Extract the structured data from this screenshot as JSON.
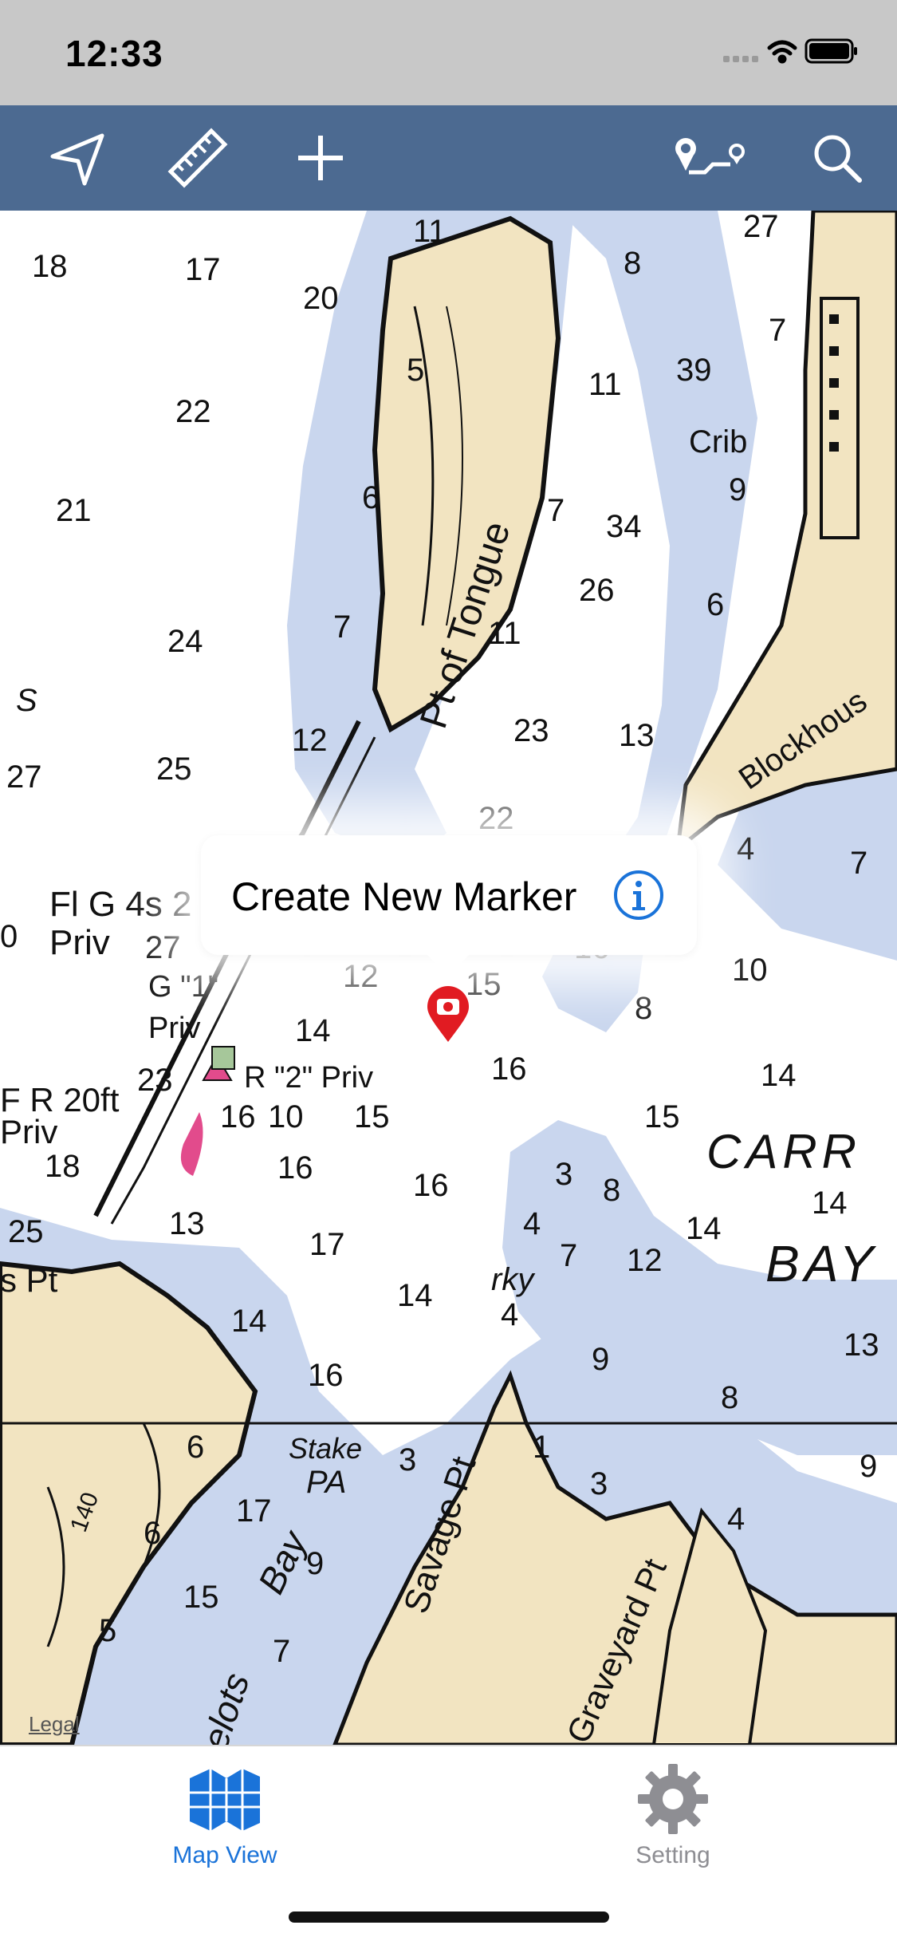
{
  "status_bar": {
    "time": "12:33",
    "icons": [
      "signal-icon",
      "wifi-icon",
      "battery-icon"
    ]
  },
  "toolbar": {
    "buttons": [
      {
        "name": "navigate-icon"
      },
      {
        "name": "ruler-icon"
      },
      {
        "name": "add-icon"
      },
      {
        "name": "route-icon"
      },
      {
        "name": "search-icon"
      }
    ],
    "background": "#4c6a91"
  },
  "map": {
    "legal_label": "Legal",
    "depth_soundings": [
      "11",
      "27",
      "18",
      "17",
      "20",
      "8",
      "7",
      "5",
      "11",
      "39",
      "22",
      "Crib",
      "9",
      "21",
      "6",
      "7",
      "34",
      "26",
      "6",
      "24",
      "7",
      "11",
      "S",
      "12",
      "23",
      "13",
      "27",
      "25",
      "22",
      "4",
      "7",
      "14",
      "27",
      "16",
      "10",
      "12",
      "15",
      "8",
      "14",
      "16",
      "14",
      "23",
      "15",
      "16",
      "10",
      "15",
      "CARR",
      "18",
      "16",
      "16",
      "3",
      "8",
      "14",
      "25",
      "13",
      "4",
      "14",
      "BAY",
      "17",
      "7",
      "12",
      "14",
      "rky",
      "4",
      "14",
      "9",
      "13",
      "16",
      "8",
      "6",
      "3",
      "1",
      "3",
      "9",
      "17",
      "6",
      "4",
      "9",
      "15",
      "5",
      "7"
    ],
    "chart_labels": {
      "pt_of_tongue": "Pt of Tongue",
      "blockhouse": "Blockhous",
      "fl_g": "Fl G 4s 2",
      "priv1": "Priv",
      "g1": "G \"1\"",
      "priv2": "Priv",
      "r2priv": "R \"2\" Priv",
      "fr20": "F R 20ft",
      "priv3": "Priv",
      "spt": "s Pt",
      "stake": "Stake",
      "pa": "PA",
      "bay": "Bay",
      "savage": "Savage Pt",
      "graveyard": "Graveyard Pt",
      "elots": "elots",
      "d140": "140",
      "zero": "0"
    },
    "colors": {
      "land": "#f2e4c1",
      "shallow": "#c9d6ee",
      "deep": "#ffffff",
      "contour": "#111111"
    }
  },
  "callout": {
    "text": "Create New Marker",
    "info_icon": "info-icon"
  },
  "tabbar": {
    "tabs": [
      {
        "label": "Map View",
        "icon": "map-icon",
        "active": true,
        "color": "#1a73d9"
      },
      {
        "label": "Setting",
        "icon": "gear-icon",
        "active": false,
        "color": "#8e8e93"
      }
    ]
  }
}
